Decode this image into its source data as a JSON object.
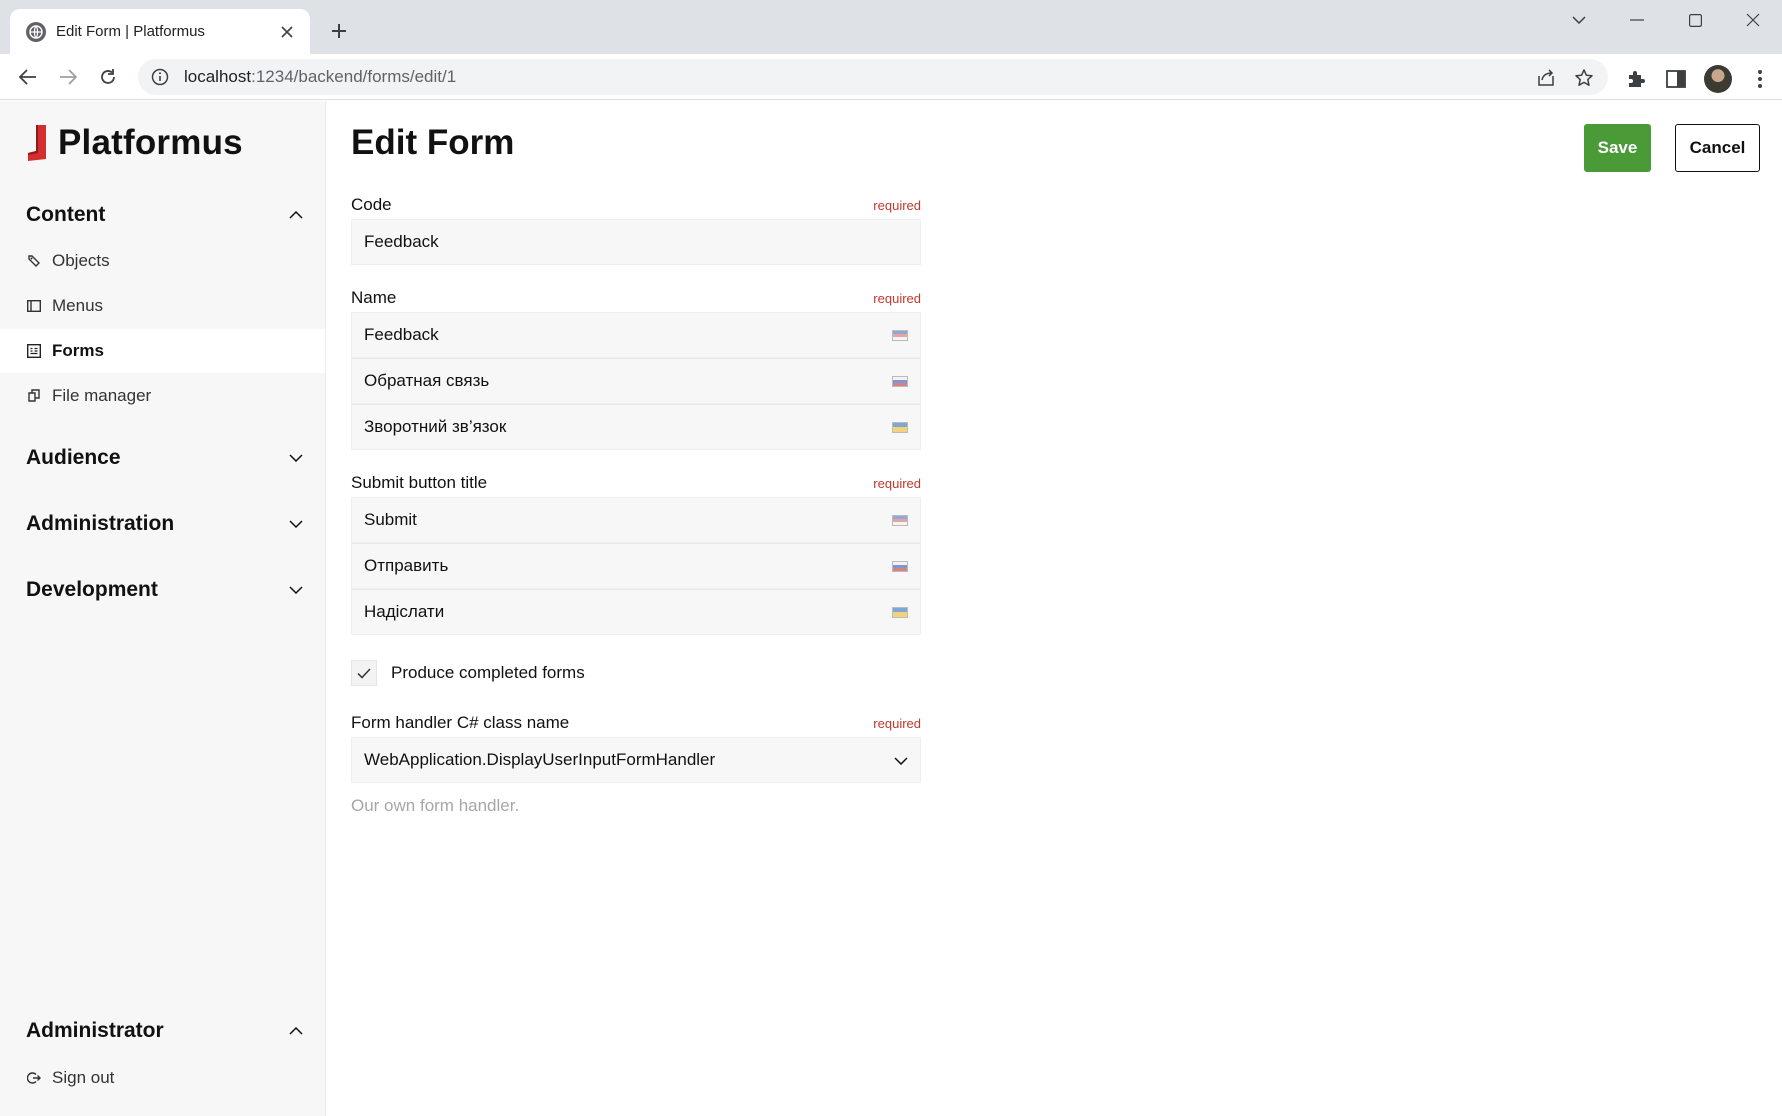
{
  "browser": {
    "tab_title": "Edit Form | Platformus",
    "url_host": "localhost",
    "url_path": ":1234/backend/forms/edit/1"
  },
  "sidebar": {
    "logo_text": "Platformus",
    "sections": [
      {
        "label": "Content",
        "expanded": true
      },
      {
        "label": "Audience",
        "expanded": false
      },
      {
        "label": "Administration",
        "expanded": false
      },
      {
        "label": "Development",
        "expanded": false
      },
      {
        "label": "Administrator",
        "expanded": true
      }
    ],
    "content_items": [
      {
        "label": "Objects",
        "icon": "objects-icon"
      },
      {
        "label": "Menus",
        "icon": "menus-icon"
      },
      {
        "label": "Forms",
        "icon": "forms-icon",
        "active": true
      },
      {
        "label": "File manager",
        "icon": "file-manager-icon"
      }
    ],
    "administrator_items": [
      {
        "label": "Sign out",
        "icon": "sign-out-icon"
      }
    ]
  },
  "main": {
    "title": "Edit Form",
    "save_label": "Save",
    "cancel_label": "Cancel",
    "required_label": "required",
    "code": {
      "label": "Code",
      "value": "Feedback"
    },
    "name": {
      "label": "Name",
      "values": [
        {
          "value": "Feedback",
          "flag": "us"
        },
        {
          "value": "Обратная связь",
          "flag": "ru"
        },
        {
          "value": "Зворотний зв’язок",
          "flag": "ua"
        }
      ]
    },
    "submit_title": {
      "label": "Submit button title",
      "values": [
        {
          "value": "Submit",
          "flag": "us"
        },
        {
          "value": "Отправить",
          "flag": "ru"
        },
        {
          "value": "Надіслати",
          "flag": "ua"
        }
      ]
    },
    "produce_completed": {
      "label": "Produce completed forms",
      "checked": true
    },
    "handler": {
      "label": "Form handler C# class name",
      "value": "WebApplication.DisplayUserInputFormHandler",
      "hint": "Our own form handler."
    }
  },
  "colors": {
    "save_button": "#4a9a38",
    "required": "#c0392b",
    "sidebar_bg": "#f7f7f7",
    "logo_red": "#d32f2f"
  }
}
